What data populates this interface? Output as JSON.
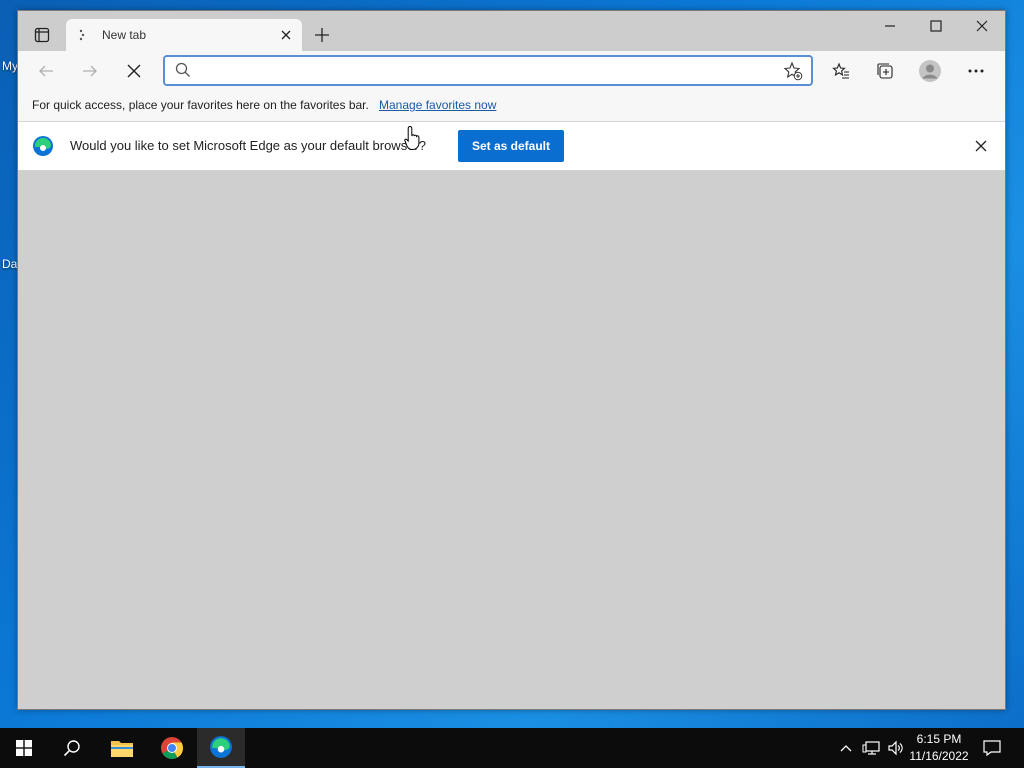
{
  "desktop": {
    "labels": [
      "My",
      "Da"
    ]
  },
  "browser": {
    "tab": {
      "title": "New tab"
    },
    "address_bar": {
      "value": "",
      "placeholder": ""
    },
    "favorites_bar": {
      "message": "For quick access, place your favorites here on the favorites bar.",
      "link": "Manage favorites now"
    },
    "infobar": {
      "message": "Would you like to set Microsoft Edge as your default browser?",
      "button": "Set as default"
    }
  },
  "taskbar": {
    "time": "6:15 PM",
    "date": "11/16/2022"
  },
  "colors": {
    "accent": "#0a6ed1",
    "link": "#1a5aa6",
    "desktop": "#0b78d6"
  }
}
